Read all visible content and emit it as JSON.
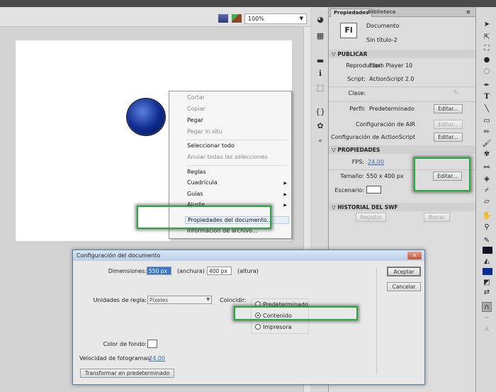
{
  "toolbar": {
    "zoom": "100%",
    "edit_scene_icon": "clapper-icon",
    "edit_symbol_icon": "symbol-icon"
  },
  "panel": {
    "tabs": [
      "Propiedades",
      "Biblioteca"
    ],
    "doc_icon": "Fl",
    "doc_type": "Documento",
    "doc_name": "Sin título-2",
    "publish": {
      "header": "PUBLICAR",
      "player_label": "Reproductor:",
      "player": "Flash Player 10",
      "script_label": "Script:",
      "script": "ActionScript 2.0",
      "class_label": "Clase:",
      "profile_label": "Perfil:",
      "profile": "Predeterminado",
      "edit": "Editar...",
      "air_label": "Configuración de AIR",
      "as_label": "Configuración de ActionScript"
    },
    "props": {
      "header": "PROPIEDADES",
      "fps_label": "FPS:",
      "fps": "24,00",
      "size_label": "Tamaño:",
      "size": "550 x 400 px",
      "edit": "Editar...",
      "stage_label": "Escenario:",
      "stage_color": "#ffffff"
    },
    "history": {
      "header": "HISTORIAL DEL SWF",
      "log": "Registro",
      "clear": "Borrar"
    }
  },
  "context_menu": {
    "items": [
      {
        "label": "Cortar",
        "disabled": true
      },
      {
        "label": "Copiar",
        "disabled": true
      },
      {
        "label": "Pegar",
        "disabled": false
      },
      {
        "label": "Pegar in situ",
        "disabled": true
      },
      {
        "label": "Seleccionar todo",
        "disabled": false
      },
      {
        "label": "Anular todas las selecciones",
        "disabled": true
      },
      {
        "label": "Reglas"
      },
      {
        "label": "Cuadrícula",
        "submenu": true
      },
      {
        "label": "Guías",
        "submenu": true
      },
      {
        "label": "Ajuste",
        "submenu": true
      },
      {
        "label": "Propiedades del documento..."
      },
      {
        "label": "Información de archivo..."
      }
    ]
  },
  "dialog": {
    "title": "Configuración del documento",
    "close": "✕",
    "dim_label": "Dimensiones:",
    "width": "550 px",
    "width_label": "(anchura) x",
    "height": "400 px",
    "height_label": "(altura)",
    "ok": "Aceptar",
    "cancel": "Cancelar",
    "units_label": "Unidades de regla:",
    "units": "Píxeles",
    "match_label": "Coincidir:",
    "match_options": [
      "Predeterminado",
      "Contenido",
      "Impresora"
    ],
    "match_selected": "Contenido",
    "bg_label": "Color de fondo:",
    "bg_color": "#ffffff",
    "fps_label": "Velocidad de fotogramas:",
    "fps": "24,00",
    "default_btn": "Transformar en predeterminado"
  },
  "colors": {
    "highlight": "#1fae3a",
    "stroke": "#111122",
    "fill": "#0a2a9a"
  }
}
